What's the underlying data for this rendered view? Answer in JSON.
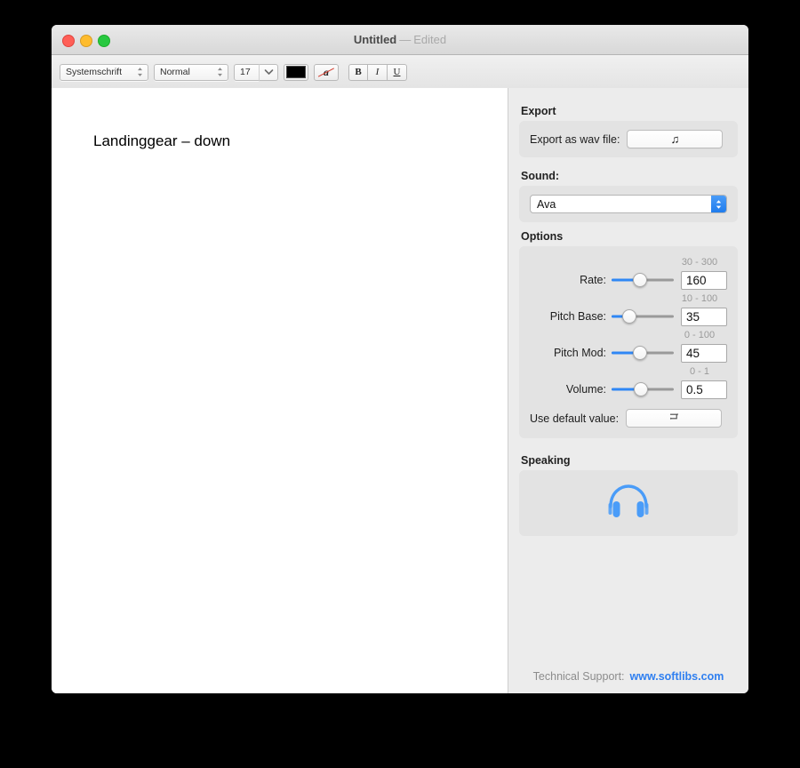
{
  "window": {
    "title": "Untitled",
    "separator": "—",
    "modified_label": "Edited",
    "traffic": {
      "close": "close-button",
      "minimize": "minimize-button",
      "maximize": "maximize-button"
    }
  },
  "toolbar": {
    "font_family": "Systemschrift",
    "font_style": "Normal",
    "font_size": "17",
    "text_color": "#000000",
    "clear_style_glyph": "a",
    "bold_label": "B",
    "italic_label": "I",
    "underline_label": "U"
  },
  "document": {
    "text": "Landinggear – down"
  },
  "sidebar": {
    "export": {
      "title": "Export",
      "row_label": "Export as wav file:",
      "button_glyph": "♫"
    },
    "sound": {
      "title": "Sound:",
      "selected": "Ava"
    },
    "options": {
      "title": "Options",
      "rows": [
        {
          "label": "Rate:",
          "range": "30 - 300",
          "value": "160",
          "percent": 45
        },
        {
          "label": "Pitch Base:",
          "range": "10 - 100",
          "value": "35",
          "percent": 28
        },
        {
          "label": "Pitch Mod:",
          "range": "0 - 100",
          "value": "45",
          "percent": 45
        },
        {
          "label": "Volume:",
          "range": "0 - 1",
          "value": "0.5",
          "percent": 47
        }
      ],
      "default_label": "Use default value:",
      "default_glyph": "↻"
    },
    "speaking": {
      "title": "Speaking",
      "icon": "headphones-icon",
      "icon_color": "#4a9cf8"
    },
    "footer": {
      "support_label": "Technical Support:",
      "link_text": "www.softlibs.com",
      "link_color": "#2f7ff0"
    }
  }
}
